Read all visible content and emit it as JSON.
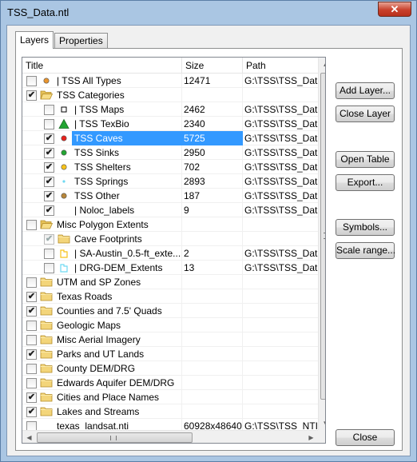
{
  "window": {
    "title": "TSS_Data.ntl",
    "close_glyph": "✕"
  },
  "tabs": [
    {
      "label": "Layers",
      "active": true
    },
    {
      "label": "Properties",
      "active": false
    }
  ],
  "columns": {
    "title": "Title",
    "size": "Size",
    "path": "Path"
  },
  "rows": [
    {
      "indent": 0,
      "checked": false,
      "icon": "point-orange-icon",
      "label": "| TSS All Types",
      "size": "12471",
      "path": "G:\\TSS\\TSS_Data"
    },
    {
      "indent": 0,
      "checked": true,
      "icon": "folder-open-icon",
      "label": "TSS Categories",
      "size": "",
      "path": ""
    },
    {
      "indent": 1,
      "checked": false,
      "icon": "square-black-icon",
      "label": "| TSS Maps",
      "size": "2462",
      "path": "G:\\TSS\\TSS_Data"
    },
    {
      "indent": 1,
      "checked": false,
      "icon": "triangle-green-icon",
      "label": "| TSS TexBio",
      "size": "2340",
      "path": "G:\\TSS\\TSS_Data"
    },
    {
      "indent": 1,
      "checked": true,
      "icon": "point-red-icon",
      "label": "TSS Caves",
      "size": "5725",
      "path": "G:\\TSS\\TSS_Data",
      "selected": true
    },
    {
      "indent": 1,
      "checked": true,
      "icon": "point-green-icon",
      "label": "TSS Sinks",
      "size": "2950",
      "path": "G:\\TSS\\TSS_Data"
    },
    {
      "indent": 1,
      "checked": true,
      "icon": "point-yellow-icon",
      "label": "TSS Shelters",
      "size": "702",
      "path": "G:\\TSS\\TSS_Data"
    },
    {
      "indent": 1,
      "checked": true,
      "icon": "point-cyan-icon",
      "label": "TSS Springs",
      "size": "2893",
      "path": "G:\\TSS\\TSS_Data"
    },
    {
      "indent": 1,
      "checked": true,
      "icon": "point-brown-icon",
      "label": "TSS Other",
      "size": "187",
      "path": "G:\\TSS\\TSS_Data"
    },
    {
      "indent": 1,
      "checked": true,
      "icon": "none",
      "label": "| Noloc_labels",
      "size": "9",
      "path": "G:\\TSS\\TSS_Data"
    },
    {
      "indent": 0,
      "checked": false,
      "icon": "folder-open-icon",
      "label": "Misc Polygon Extents",
      "size": "",
      "path": ""
    },
    {
      "indent": 1,
      "checked": true,
      "disabled": true,
      "icon": "folder-icon",
      "label": "Cave Footprints",
      "size": "",
      "path": ""
    },
    {
      "indent": 1,
      "checked": false,
      "icon": "polygon-yellow-icon",
      "label": "| SA-Austin_0.5-ft_exte...",
      "size": "2",
      "path": "G:\\TSS\\TSS_Data"
    },
    {
      "indent": 1,
      "checked": false,
      "icon": "polygon-cyan-icon",
      "label": "| DRG-DEM_Extents",
      "size": "13",
      "path": "G:\\TSS\\TSS_Data"
    },
    {
      "indent": 0,
      "checked": false,
      "icon": "folder-icon",
      "label": "UTM and SP Zones",
      "size": "",
      "path": ""
    },
    {
      "indent": 0,
      "checked": true,
      "icon": "folder-icon",
      "label": "Texas Roads",
      "size": "",
      "path": ""
    },
    {
      "indent": 0,
      "checked": true,
      "icon": "folder-icon",
      "label": "Counties and 7.5' Quads",
      "size": "",
      "path": ""
    },
    {
      "indent": 0,
      "checked": false,
      "icon": "folder-icon",
      "label": "Geologic Maps",
      "size": "",
      "path": ""
    },
    {
      "indent": 0,
      "checked": false,
      "icon": "folder-icon",
      "label": "Misc Aerial Imagery",
      "size": "",
      "path": ""
    },
    {
      "indent": 0,
      "checked": true,
      "icon": "folder-icon",
      "label": "Parks and UT Lands",
      "size": "",
      "path": ""
    },
    {
      "indent": 0,
      "checked": false,
      "icon": "folder-icon",
      "label": "County DEM/DRG",
      "size": "",
      "path": ""
    },
    {
      "indent": 0,
      "checked": false,
      "icon": "folder-icon",
      "label": "Edwards Aquifer DEM/DRG",
      "size": "",
      "path": ""
    },
    {
      "indent": 0,
      "checked": true,
      "icon": "folder-icon",
      "label": "Cities and Place Names",
      "size": "",
      "path": ""
    },
    {
      "indent": 0,
      "checked": true,
      "icon": "folder-icon",
      "label": "Lakes and Streams",
      "size": "",
      "path": ""
    },
    {
      "indent": 0,
      "checked": false,
      "icon": "none",
      "label": "texas_landsat.nti",
      "size": "60928x48640",
      "path": "G:\\TSS\\TSS_NTI\\"
    }
  ],
  "buttons": {
    "add_layer": "Add Layer...",
    "close_layer": "Close Layer",
    "open_table": "Open Table",
    "export": "Export...",
    "symbols": "Symbols...",
    "scale_range": "Scale range...",
    "close": "Close"
  },
  "colors": {
    "selection": "#3399ff",
    "red": "#e8221c",
    "green": "#22a532",
    "yellow": "#f7c21a",
    "cyan": "#6fd9f2",
    "brown": "#b7863a",
    "orange": "#e9952f"
  }
}
